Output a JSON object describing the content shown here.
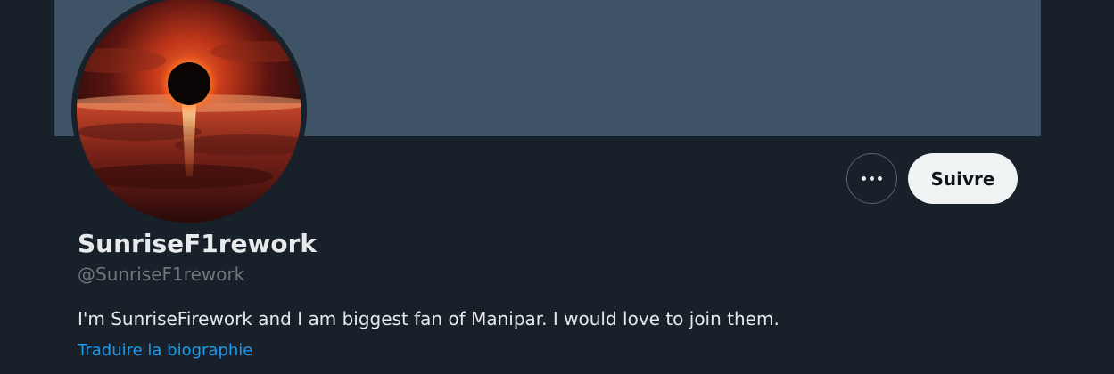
{
  "profile": {
    "display_name": "SunriseF1rework",
    "handle": "@SunriseF1rework",
    "bio": "I'm SunriseFirework and I am biggest fan of Manipar. I would love to join them.",
    "translate_bio_label": "Traduire la biographie"
  },
  "actions": {
    "more_icon": "more-horizontal-icon",
    "follow_label": "Suivre"
  },
  "colors": {
    "background": "#18202a",
    "banner": "#3e5366",
    "primary_text": "#e7e9ea",
    "secondary_text": "#71767b",
    "link": "#1d9bf0",
    "follow_button_bg": "#eff3f4"
  }
}
